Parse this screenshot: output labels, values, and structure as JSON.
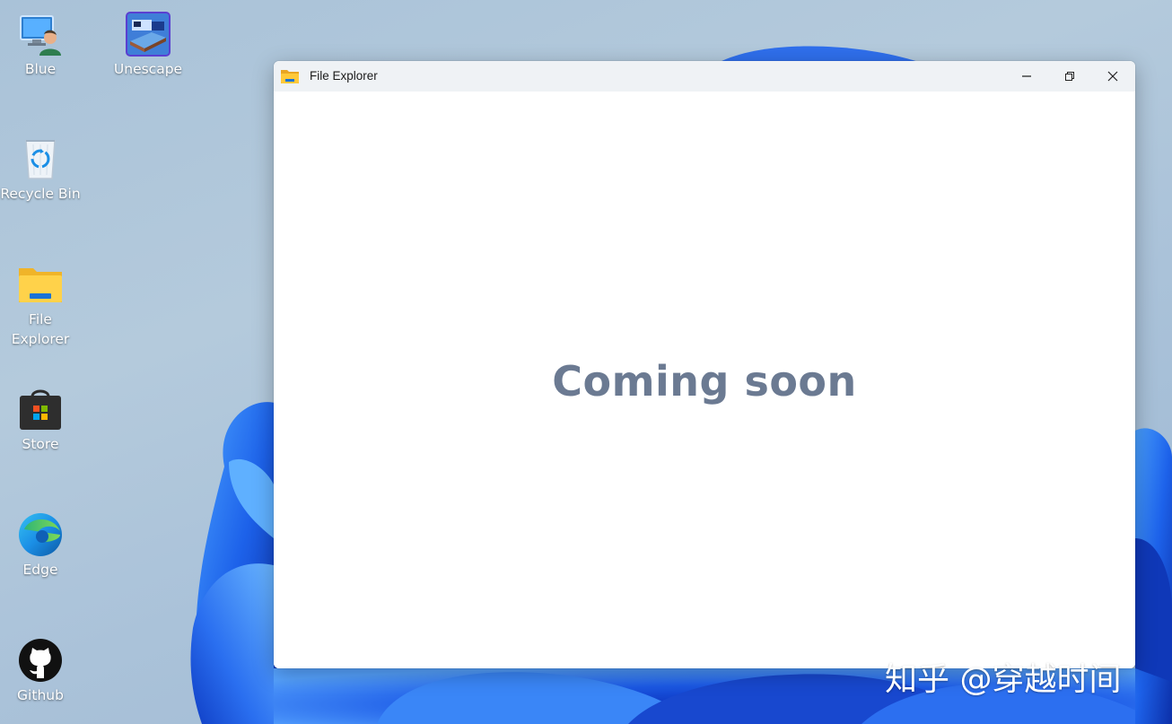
{
  "desktop": {
    "icons": [
      {
        "label": "Blue"
      },
      {
        "label": "Unescape"
      },
      {
        "label": "Recycle Bin"
      },
      {
        "label": "File Explorer"
      },
      {
        "label": "Store"
      },
      {
        "label": "Edge"
      },
      {
        "label": "Github"
      }
    ]
  },
  "window": {
    "title": "File Explorer",
    "content_text": "Coming soon",
    "icons": {
      "app": "folder-icon",
      "minimize": "minimize-icon",
      "maximize": "restore-icon",
      "close": "close-icon"
    }
  },
  "watermark": {
    "text": "知乎 @穿越时间"
  },
  "colors": {
    "window_content_text": "#6b7a92",
    "titlebar_bg": "#eff2f5",
    "wallpaper_blue": "#1f5fe0"
  }
}
